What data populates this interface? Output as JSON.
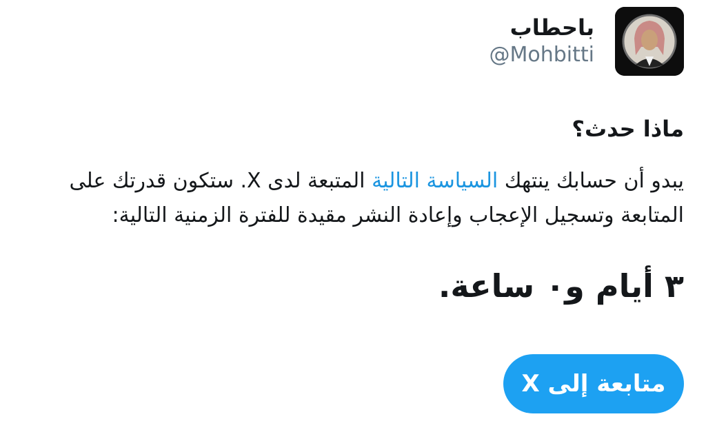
{
  "account": {
    "display_name": "باحطاب",
    "handle": "@Mohbitti",
    "avatar_icon": "profile-photo"
  },
  "notice": {
    "heading": "ماذا حدث؟",
    "body_before_link": "يبدو أن حسابك ينتهك ",
    "policy_link": "السياسة التالية",
    "body_after_link": " المتبعة لدى X. ستكون قدرتك على المتابعة وتسجيل الإعجاب وإعادة النشر مقيدة للفترة الزمنية التالية:",
    "duration": "٣ أيام و٠ ساعة.",
    "continue_label": "متابعة إلى X"
  },
  "colors": {
    "link": "#1b95e0",
    "button": "#1da1f2",
    "muted": "#657786"
  }
}
